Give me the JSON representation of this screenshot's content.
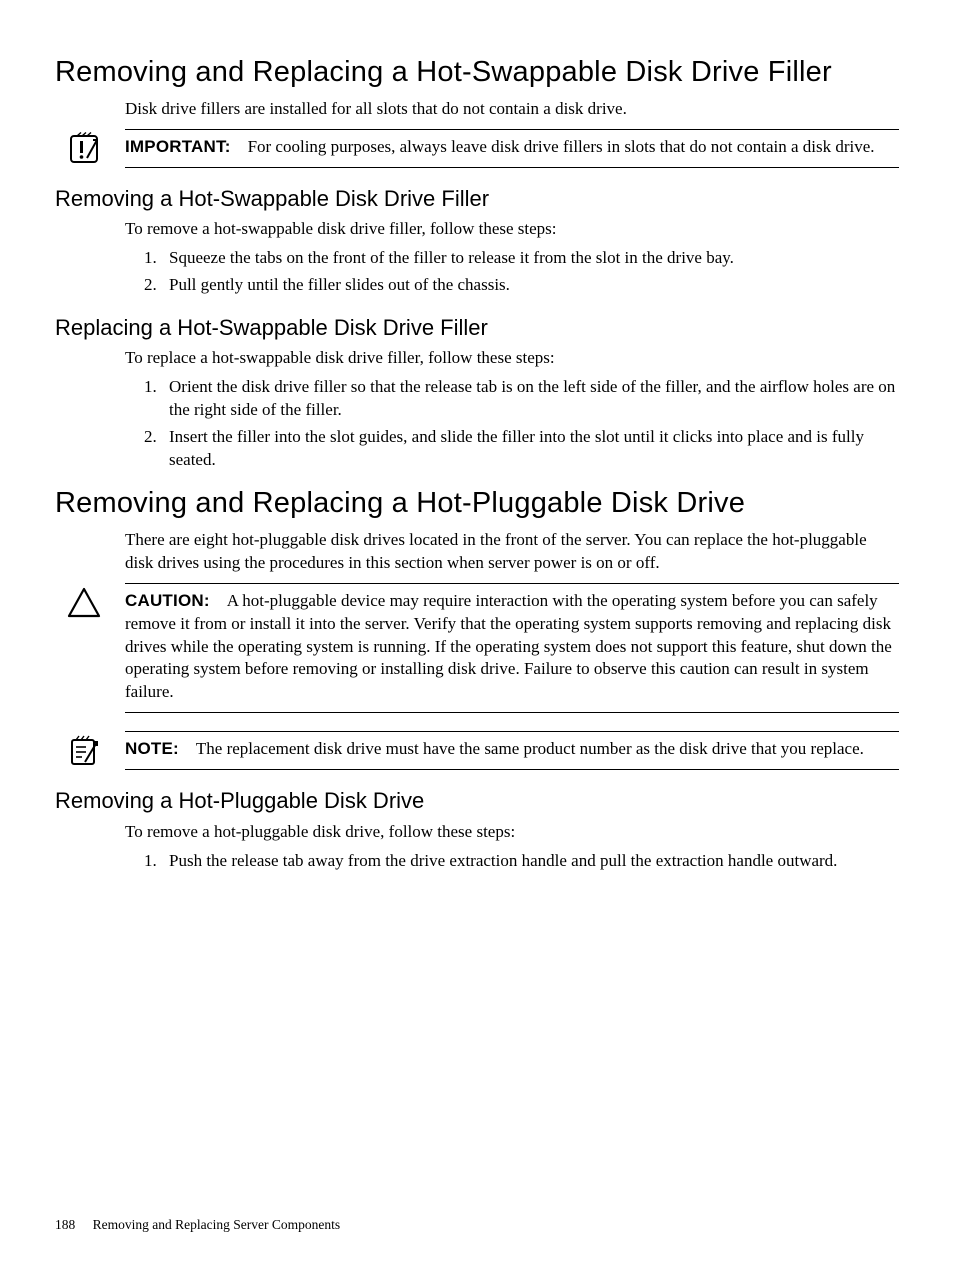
{
  "s1": {
    "title": "Removing and Replacing a Hot-Swappable Disk Drive Filler",
    "intro": "Disk drive fillers are installed for all slots that do not contain a disk drive.",
    "important": {
      "label": "IMPORTANT:",
      "text": "For cooling purposes, always leave disk drive fillers in slots that do not contain a disk drive."
    },
    "s1a": {
      "title": "Removing a Hot-Swappable Disk Drive Filler",
      "intro": "To remove a hot-swappable disk drive filler, follow these steps:",
      "steps": [
        "Squeeze the tabs on the front of the filler to release it from the slot in the drive bay.",
        "Pull gently until the filler slides out of the chassis."
      ]
    },
    "s1b": {
      "title": "Replacing a Hot-Swappable Disk Drive Filler",
      "intro": "To replace a hot-swappable disk drive filler, follow these steps:",
      "steps": [
        "Orient the disk drive filler so that the release tab is on the left side of the filler, and the airflow holes are on the right side of the filler.",
        "Insert the filler into the slot guides, and slide the filler into the slot until it clicks into place and is fully seated."
      ]
    }
  },
  "s2": {
    "title": "Removing and Replacing a Hot-Pluggable Disk Drive",
    "intro": "There are eight hot-pluggable disk drives located in the front of the server. You can replace the hot-pluggable disk drives using the procedures in this section when server power is on or off.",
    "caution": {
      "label": "CAUTION:",
      "text": "A hot-pluggable device may require interaction with the operating system before you can safely remove it from or install it into the server. Verify that the operating system supports removing and replacing disk drives while the operating system is running. If the operating system does not support this feature, shut down the operating system before removing or installing disk drive. Failure to observe this caution can result in system failure."
    },
    "note": {
      "label": "NOTE:",
      "text": "The replacement disk drive must have the same product number as the disk drive that you replace."
    },
    "s2a": {
      "title": "Removing a Hot-Pluggable Disk Drive",
      "intro": "To remove a hot-pluggable disk drive, follow these steps:",
      "steps": [
        "Push the release tab away from the drive extraction handle and pull the extraction handle outward."
      ]
    }
  },
  "footer": {
    "page": "188",
    "section": "Removing and Replacing Server Components"
  }
}
